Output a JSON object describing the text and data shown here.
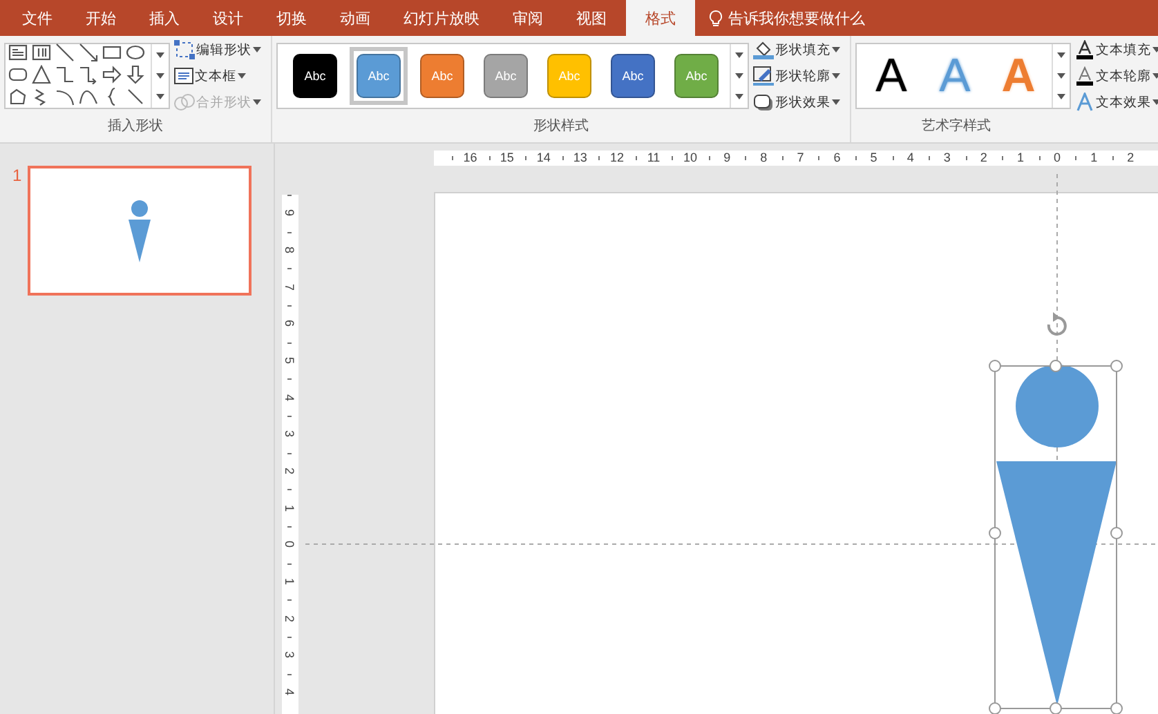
{
  "tabs": [
    {
      "label": "文件",
      "selected": false
    },
    {
      "label": "开始",
      "selected": false
    },
    {
      "label": "插入",
      "selected": false
    },
    {
      "label": "设计",
      "selected": false
    },
    {
      "label": "切换",
      "selected": false
    },
    {
      "label": "动画",
      "selected": false
    },
    {
      "label": "幻灯片放映",
      "selected": false
    },
    {
      "label": "审阅",
      "selected": false
    },
    {
      "label": "视图",
      "selected": false
    },
    {
      "label": "格式",
      "selected": true
    }
  ],
  "tell_me": "告诉我你想要做什么",
  "insert_shapes": {
    "label": "插入形状",
    "commands": [
      {
        "label": "编辑形状",
        "kind": "edit",
        "disabled": false
      },
      {
        "label": "文本框",
        "kind": "textbox",
        "disabled": false
      },
      {
        "label": "合并形状",
        "kind": "merge",
        "disabled": true
      }
    ]
  },
  "shape_styles": {
    "label": "形状样式",
    "swatches": [
      {
        "text": "Abc",
        "color": "#000000",
        "selected": false
      },
      {
        "text": "Abc",
        "color": "#5b9bd5",
        "selected": true
      },
      {
        "text": "Abc",
        "color": "#ed7d31",
        "selected": false
      },
      {
        "text": "Abc",
        "color": "#a5a5a5",
        "selected": false
      },
      {
        "text": "Abc",
        "color": "#ffc000",
        "selected": false
      },
      {
        "text": "Abc",
        "color": "#4472c4",
        "selected": false
      },
      {
        "text": "Abc",
        "color": "#70ad47",
        "selected": false
      }
    ],
    "commands": [
      {
        "label": "形状填充",
        "kind": "fill"
      },
      {
        "label": "形状轮廓",
        "kind": "outline"
      },
      {
        "label": "形状效果",
        "kind": "effect"
      }
    ]
  },
  "wordart": {
    "label": "艺术字样式",
    "letters": [
      {
        "text": "A",
        "kind": "solid",
        "color": "#000000"
      },
      {
        "text": "A",
        "kind": "soft",
        "color": "#5b9bd5"
      },
      {
        "text": "A",
        "kind": "outline",
        "color": "#ed7d31"
      }
    ],
    "commands": [
      {
        "label": "文本填充",
        "kind": "fill"
      },
      {
        "label": "文本轮廓",
        "kind": "outline"
      },
      {
        "label": "文本效果",
        "kind": "effect"
      }
    ]
  },
  "slides": [
    {
      "number": "1",
      "selected": true
    }
  ],
  "ruler_horizontal": [
    "16",
    "15",
    "14",
    "13",
    "12",
    "11",
    "10",
    "9",
    "8",
    "7",
    "6",
    "5",
    "4",
    "3",
    "2",
    "1",
    "0",
    "1",
    "2"
  ],
  "ruler_vertical": [
    "9",
    "8",
    "7",
    "6",
    "5",
    "4",
    "3",
    "2",
    "1",
    "0",
    "1",
    "2",
    "3",
    "4"
  ],
  "canvas": {
    "shape_selected": true
  }
}
